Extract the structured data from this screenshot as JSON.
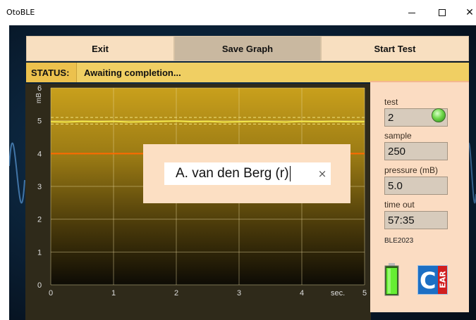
{
  "window": {
    "title": "OtoBLE",
    "minimize_glyph": "",
    "maximize_glyph": "",
    "close_glyph": "✕"
  },
  "toolbar": {
    "exit_label": "Exit",
    "save_label": "Save Graph",
    "start_label": "Start Test"
  },
  "status": {
    "label": "STATUS:",
    "text": "Awaiting completion..."
  },
  "panel": {
    "test_label": "test",
    "test_value": "2",
    "sample_label": "sample",
    "sample_value": "250",
    "pressure_label": "pressure (mB)",
    "pressure_value": "5.0",
    "timeout_label": "time out",
    "timeout_value": "57:35",
    "device_id": "BLE2023",
    "indicator_color": "#6fd84a",
    "battery_icon": "battery-full-icon",
    "logo_letter": "C",
    "logo_text": "EAR"
  },
  "dialog": {
    "input_value": "A. van den Berg (r)",
    "clear_glyph": "×"
  },
  "chart_data": {
    "type": "line",
    "title": "",
    "xlabel": "sec.",
    "ylabel": "mB",
    "xlim": [
      0,
      5
    ],
    "ylim": [
      0,
      6
    ],
    "x_ticks": [
      0,
      1,
      2,
      3,
      4,
      5
    ],
    "y_ticks": [
      0,
      1,
      2,
      3,
      4,
      5,
      6
    ],
    "grid": true,
    "series": [
      {
        "color": "#f3e84a",
        "style": "solid",
        "x": [
          0,
          0.25,
          0.5,
          0.75,
          1,
          1.25,
          1.5,
          1.75,
          2,
          2.25,
          2.5,
          2.75,
          3,
          3.25,
          3.5,
          3.75,
          4,
          4.25,
          4.5,
          4.75,
          5
        ],
        "values": [
          4.97,
          4.96,
          4.98,
          4.97,
          4.98,
          4.96,
          4.97,
          4.98,
          4.99,
          4.97,
          4.98,
          4.96,
          4.97,
          4.98,
          4.97,
          4.96,
          4.98,
          4.97,
          4.98,
          4.97,
          4.97
        ]
      }
    ],
    "reference_lines": [
      {
        "y": 5.1,
        "color": "#f1e480",
        "style": "dashed"
      },
      {
        "y": 4.9,
        "color": "#f1e480",
        "style": "dashed"
      },
      {
        "y": 4.0,
        "color": "#ff6a00",
        "style": "solid"
      }
    ]
  }
}
